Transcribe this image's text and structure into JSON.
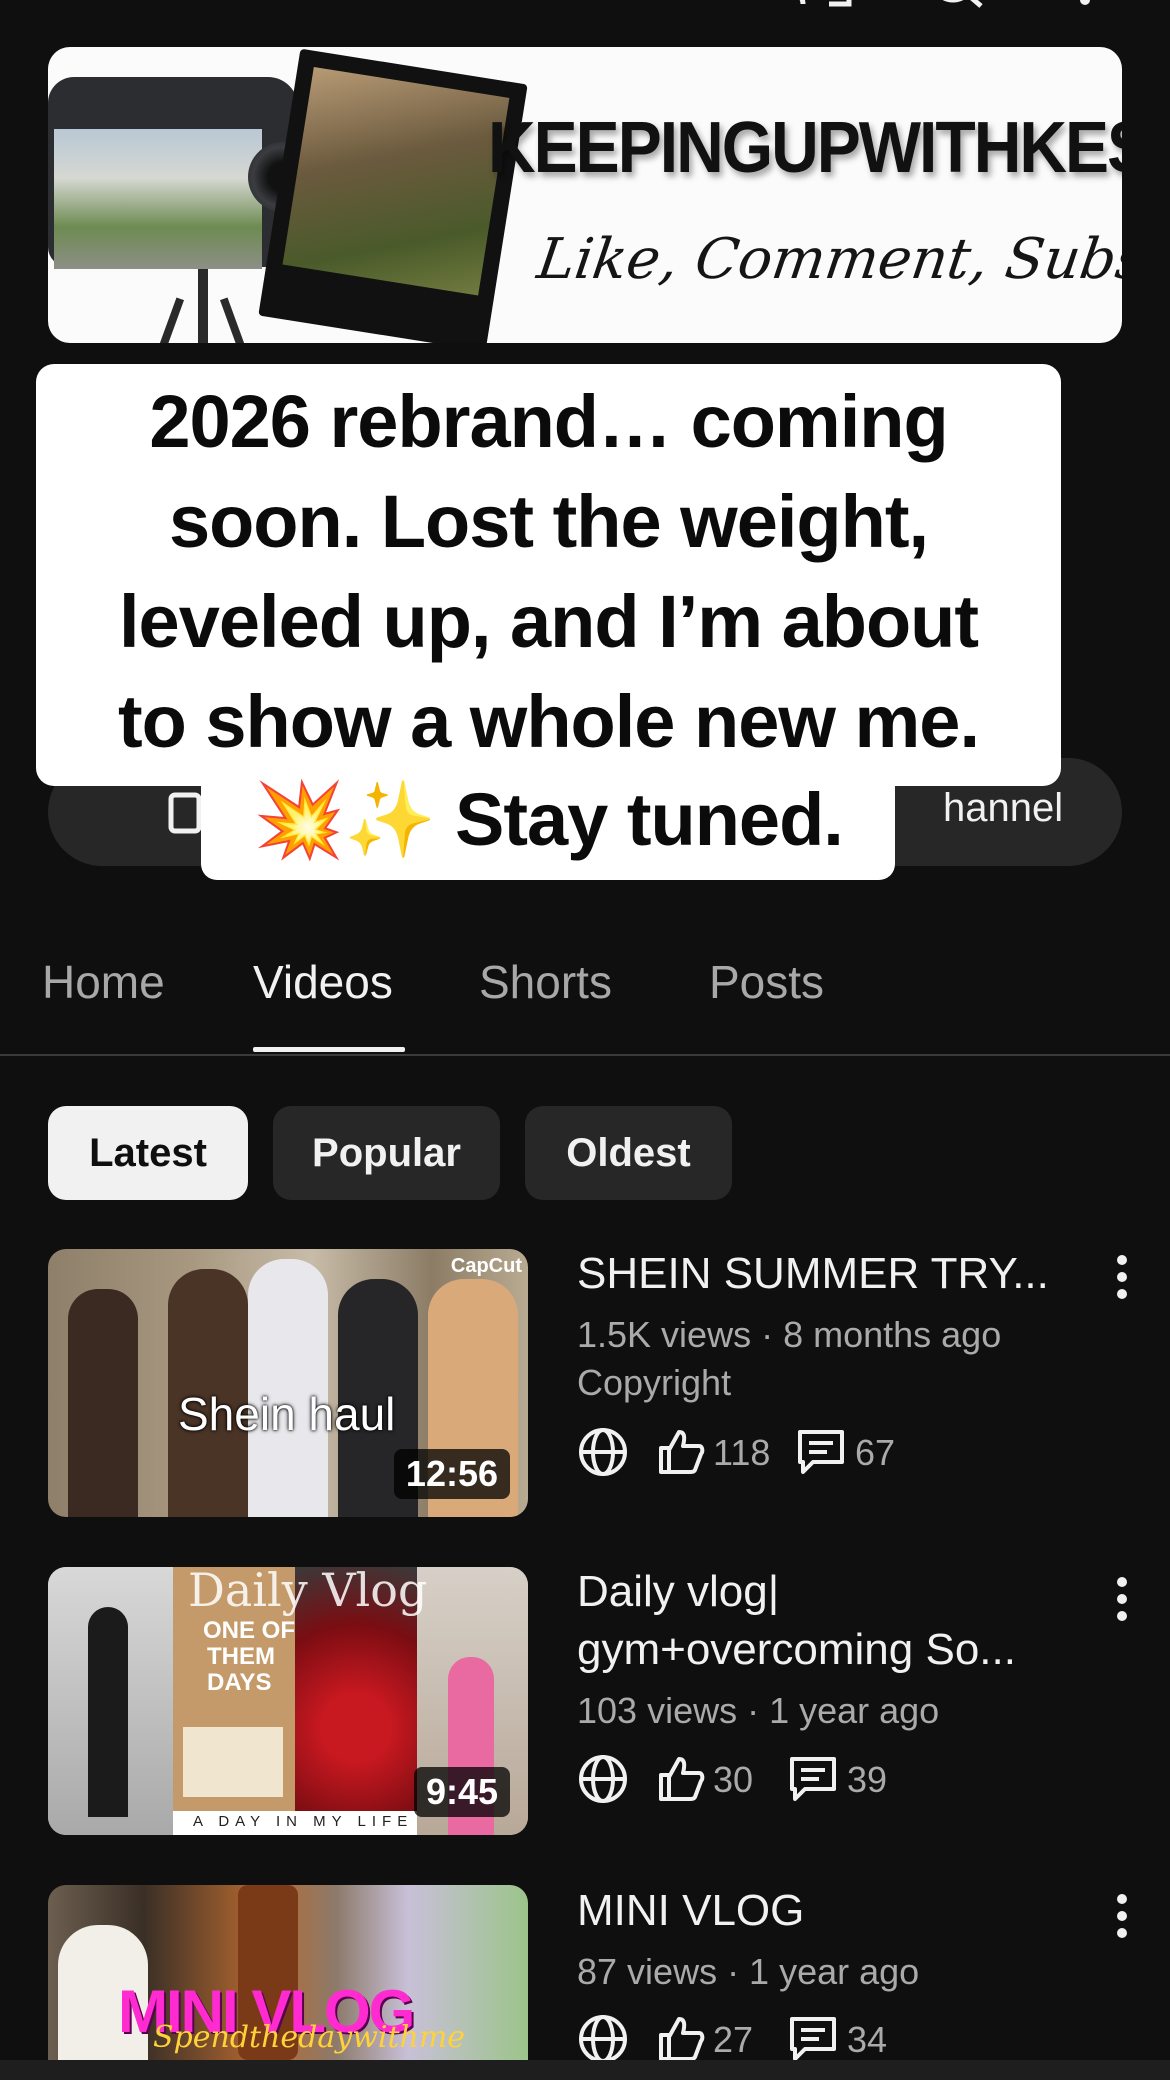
{
  "banner": {
    "title": "KEEPINGUPWITHKESH",
    "tagline": "Like, Comment, Subscribe!"
  },
  "overlay": {
    "lines": [
      "2026 rebrand… coming",
      "soon. Lost the weight,",
      "leveled up, and I’m about",
      "to show a whole new me."
    ],
    "last_line": "💥✨ Stay tuned."
  },
  "action_pill": {
    "label": "hannel"
  },
  "tabs": [
    {
      "label": "Home",
      "active": false
    },
    {
      "label": "Videos",
      "active": true
    },
    {
      "label": "Shorts",
      "active": false
    },
    {
      "label": "Posts",
      "active": false
    }
  ],
  "filters": [
    {
      "label": "Latest",
      "selected": true
    },
    {
      "label": "Popular",
      "selected": false
    },
    {
      "label": "Oldest",
      "selected": false
    }
  ],
  "videos": [
    {
      "title": "SHEIN SUMMER TRY...",
      "meta": "1.5K views · 8 months ago",
      "extra": "Copyright",
      "likes": "118",
      "comments": "67",
      "duration": "12:56",
      "thumb_text": "Shein haul",
      "thumb_badge": "CapCut"
    },
    {
      "title_line1": "Daily vlog|",
      "title_line2": "gym+overcoming So...",
      "meta": "103 views · 1 year ago",
      "likes": "30",
      "comments": "39",
      "duration": "9:45",
      "thumb_text": "Daily Vlog",
      "thumb_poster_line1": "ONE OF",
      "thumb_poster_line2": "THEM",
      "thumb_poster_line3": "DAYS",
      "thumb_caption": "A DAY IN MY LIFE"
    },
    {
      "title": "MINI VLOG",
      "meta": "87 views · 1 year ago",
      "likes": "27",
      "comments": "34",
      "thumb_text": "MINI VLOG",
      "thumb_subtext": "Spendthedaywithme"
    }
  ]
}
